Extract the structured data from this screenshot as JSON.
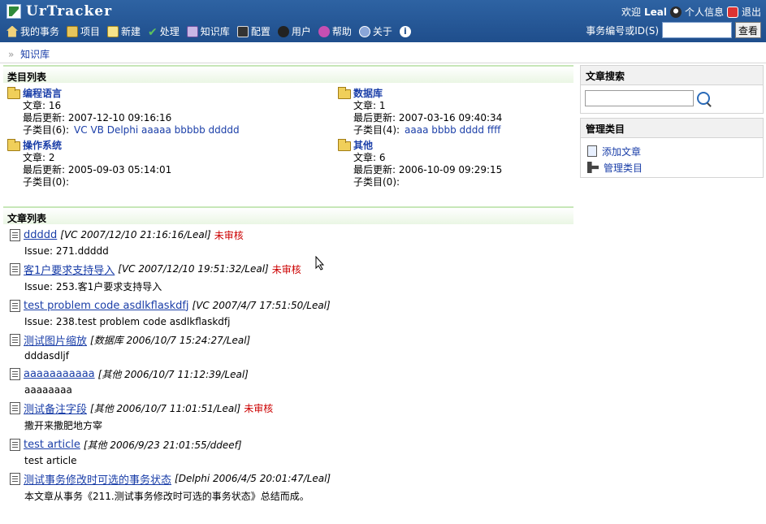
{
  "app": {
    "title": "UrTracker"
  },
  "topbar": {
    "welcome": "欢迎",
    "user": "Leal",
    "profile": "个人信息",
    "logout": "退出"
  },
  "menu": [
    {
      "label": "我的事务",
      "icon": "home-icon"
    },
    {
      "label": "项目",
      "icon": "project-icon"
    },
    {
      "label": "新建",
      "icon": "new-icon"
    },
    {
      "label": "处理",
      "icon": "check-icon"
    },
    {
      "label": "知识库",
      "icon": "knowledge-icon"
    },
    {
      "label": "配置",
      "icon": "config-icon"
    },
    {
      "label": "用户",
      "icon": "user-icon"
    },
    {
      "label": "帮助",
      "icon": "help-icon"
    },
    {
      "label": "关于",
      "icon": "about-icon"
    }
  ],
  "search": {
    "label": "事务编号或ID(S)",
    "value": "",
    "button": "查看"
  },
  "breadcrumb": {
    "sep": "»",
    "current": "知识库"
  },
  "categories": {
    "title": "类目列表",
    "items": [
      {
        "name": "编程语言",
        "articles": "文章: 16",
        "updated": "最后更新: 2007-12-10 09:16:16",
        "subs_label": "子类目(6):",
        "subs": "VC VB Delphi aaaaa bbbbb ddddd"
      },
      {
        "name": "数据库",
        "articles": "文章: 1",
        "updated": "最后更新: 2007-03-16 09:40:34",
        "subs_label": "子类目(4):",
        "subs": "aaaa bbbb dddd ffff"
      },
      {
        "name": "操作系统",
        "articles": "文章: 2",
        "updated": "最后更新: 2005-09-03 05:14:01",
        "subs_label": "子类目(0):",
        "subs": ""
      },
      {
        "name": "其他",
        "articles": "文章: 6",
        "updated": "最后更新: 2006-10-09 09:29:15",
        "subs_label": "子类目(0):",
        "subs": ""
      }
    ]
  },
  "articles": {
    "title": "文章列表",
    "items": [
      {
        "title": "ddddd",
        "meta": "[VC  2007/12/10 21:16:16/Leal]",
        "status": "未审核",
        "desc": "Issue: 271.ddddd"
      },
      {
        "title": "客1户要求支持导入",
        "meta": "[VC  2007/12/10 19:51:32/Leal]",
        "status": "未审核",
        "desc": "Issue: 253.客1户要求支持导入"
      },
      {
        "title": "test problem code asdlkflaskdfj",
        "meta": "[VC  2007/4/7 17:51:50/Leal]",
        "status": "",
        "desc": "Issue: 238.test problem code asdlkflaskdfj"
      },
      {
        "title": "测试图片缩放",
        "meta": "[数据库  2006/10/7 15:24:27/Leal]",
        "status": "",
        "desc": "dddasdljf"
      },
      {
        "title": "aaaaaaaaaaa",
        "meta": "[其他  2006/10/7 11:12:39/Leal]",
        "status": "",
        "desc": "aaaaaaaa"
      },
      {
        "title": "测试备注字段",
        "meta": "[其他  2006/10/7 11:01:51/Leal]",
        "status": "未审核",
        "desc": "撒开来撒肥地方宰"
      },
      {
        "title": "test article",
        "meta": "[其他  2006/9/23 21:01:55/ddeef]",
        "status": "",
        "desc": "test article"
      },
      {
        "title": "测试事务修改时可选的事务状态",
        "meta": "[Delphi  2006/4/5 20:01:47/Leal]",
        "status": "",
        "desc": "本文章从事务《211.测试事务修改时可选的事务状态》总结而成。"
      }
    ]
  },
  "sidebar": {
    "search": {
      "title": "文章搜索",
      "value": ""
    },
    "manage": {
      "title": "管理类目",
      "add": "添加文章",
      "manage": "管理类目"
    }
  }
}
